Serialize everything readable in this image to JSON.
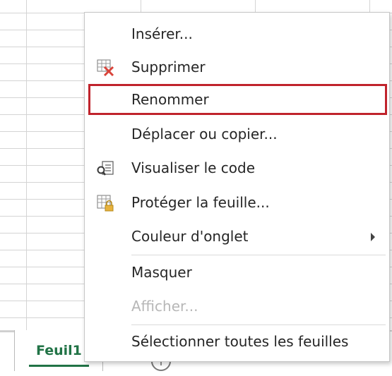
{
  "menu": {
    "items": [
      {
        "label": "Insérer...",
        "enabled": true
      },
      {
        "label": "Supprimer",
        "enabled": true,
        "icon": "delete-sheet-icon"
      },
      {
        "label": "Renommer",
        "enabled": true,
        "highlighted": true
      },
      {
        "label": "Déplacer ou copier...",
        "enabled": true
      },
      {
        "label": "Visualiser le code",
        "enabled": true,
        "icon": "view-code-icon"
      },
      {
        "label": "Protéger la feuille...",
        "enabled": true,
        "icon": "protect-sheet-icon"
      },
      {
        "label": "Couleur d'onglet",
        "enabled": true,
        "submenu": true
      },
      {
        "label": "Masquer",
        "enabled": true
      },
      {
        "label": "Afficher...",
        "enabled": false
      },
      {
        "label": "Sélectionner toutes les feuilles",
        "enabled": true
      }
    ]
  },
  "sheets": {
    "active_tab": "Feuil1",
    "add_symbol": "+"
  },
  "colors": {
    "accent": "#217346",
    "highlight_border": "#c0232c",
    "delete_x": "#d9433a",
    "lock": "#e8b23c"
  }
}
